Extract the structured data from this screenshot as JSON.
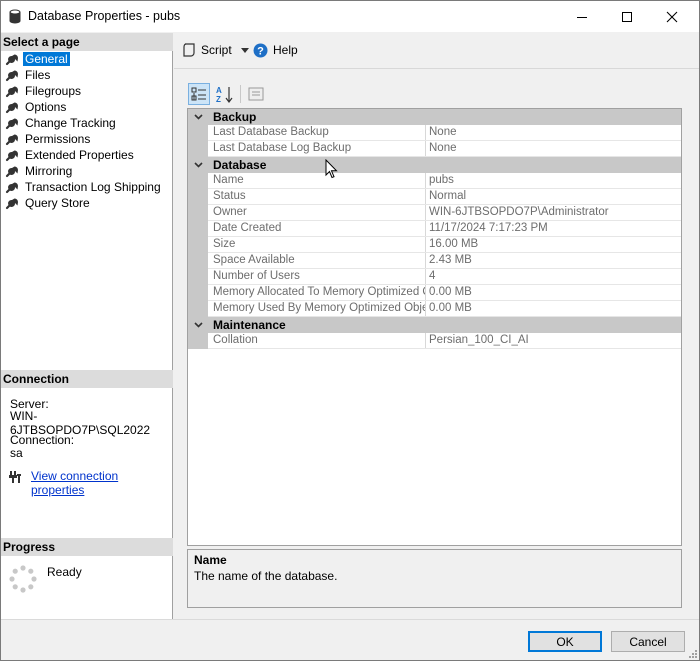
{
  "window": {
    "title": "Database Properties - pubs",
    "controls": [
      "minimize",
      "maximize",
      "close"
    ]
  },
  "left_pane": {
    "select_page_header": "Select a page",
    "pages": [
      {
        "label": "General",
        "selected": true
      },
      {
        "label": "Files",
        "selected": false
      },
      {
        "label": "Filegroups",
        "selected": false
      },
      {
        "label": "Options",
        "selected": false
      },
      {
        "label": "Change Tracking",
        "selected": false
      },
      {
        "label": "Permissions",
        "selected": false
      },
      {
        "label": "Extended Properties",
        "selected": false
      },
      {
        "label": "Mirroring",
        "selected": false
      },
      {
        "label": "Transaction Log Shipping",
        "selected": false
      },
      {
        "label": "Query Store",
        "selected": false
      }
    ],
    "connection": {
      "header": "Connection",
      "server_label": "Server:",
      "server_value": "WIN-6JTBSOPDO7P\\SQL2022",
      "connection_label": "Connection:",
      "connection_value": "sa",
      "view_link": "View connection properties"
    },
    "progress": {
      "header": "Progress",
      "status": "Ready"
    }
  },
  "toolbar": {
    "script_label": "Script",
    "help_label": "Help"
  },
  "grid": {
    "categories": [
      {
        "name": "Backup",
        "rows": [
          {
            "name": "Last Database Backup",
            "value": "None"
          },
          {
            "name": "Last Database Log Backup",
            "value": "None"
          }
        ]
      },
      {
        "name": "Database",
        "rows": [
          {
            "name": "Name",
            "value": "pubs"
          },
          {
            "name": "Status",
            "value": "Normal"
          },
          {
            "name": "Owner",
            "value": "WIN-6JTBSOPDO7P\\Administrator"
          },
          {
            "name": "Date Created",
            "value": "11/17/2024 7:17:23 PM"
          },
          {
            "name": "Size",
            "value": "16.00 MB"
          },
          {
            "name": "Space Available",
            "value": "2.43 MB"
          },
          {
            "name": "Number of Users",
            "value": "4"
          },
          {
            "name": "Memory Allocated To Memory Optimized Obje",
            "value": "0.00 MB"
          },
          {
            "name": "Memory Used By Memory Optimized Objects",
            "value": "0.00 MB"
          }
        ]
      },
      {
        "name": "Maintenance",
        "rows": [
          {
            "name": "Collation",
            "value": "Persian_100_CI_AI"
          }
        ]
      }
    ]
  },
  "description": {
    "title": "Name",
    "text": "The name of the database."
  },
  "buttons": {
    "ok": "OK",
    "cancel": "Cancel"
  },
  "colors": {
    "selection": "#0078d7",
    "link": "#0033cc",
    "category_bg": "#c8c8c8"
  }
}
